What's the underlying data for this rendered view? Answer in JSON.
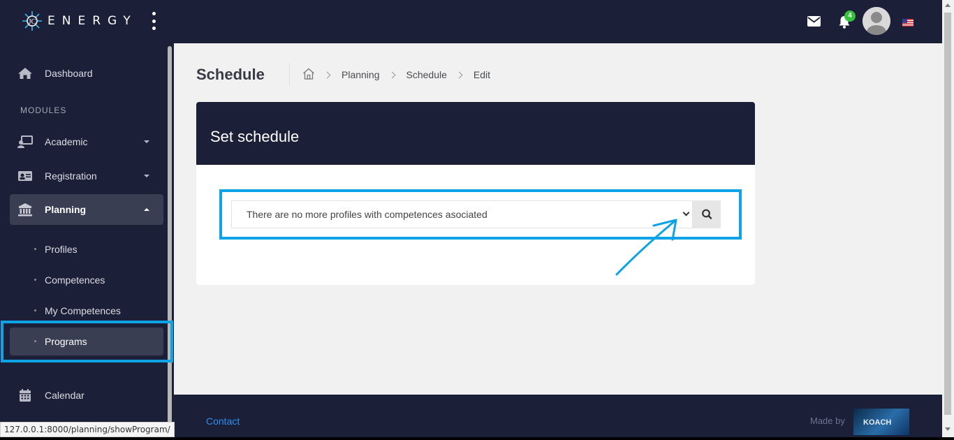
{
  "brand": {
    "name": "ENERGY"
  },
  "header": {
    "notifications_count": "4",
    "icons": [
      "envelope-icon",
      "bell-icon",
      "user-avatar",
      "us-flag-icon"
    ]
  },
  "sidebar": {
    "dashboard": "Dashboard",
    "section_label": "MODULES",
    "items": [
      {
        "label": "Academic",
        "icon": "chalkboard-teacher-icon",
        "expanded": false
      },
      {
        "label": "Registration",
        "icon": "id-card-icon",
        "expanded": false
      },
      {
        "label": "Planning",
        "icon": "university-icon",
        "expanded": true
      }
    ],
    "planning_sub": [
      "Profiles",
      "Competences",
      "My Competences",
      "Programs"
    ],
    "calendar": "Calendar"
  },
  "main": {
    "title": "Schedule",
    "breadcrumb": [
      "Planning",
      "Schedule",
      "Edit"
    ],
    "card_title": "Set schedule",
    "select_value": "There are no more profiles with competences asociated"
  },
  "footer": {
    "contact": "Contact",
    "made_by": "Made by",
    "maker_logo_text": "KOACH"
  },
  "status_bar_url": "127.0.0.1:8000/planning/showProgram/",
  "colors": {
    "navy": "#1b1f38",
    "highlight": "#0ea2e6",
    "link": "#2f8ff0",
    "badge": "#35c23b"
  }
}
